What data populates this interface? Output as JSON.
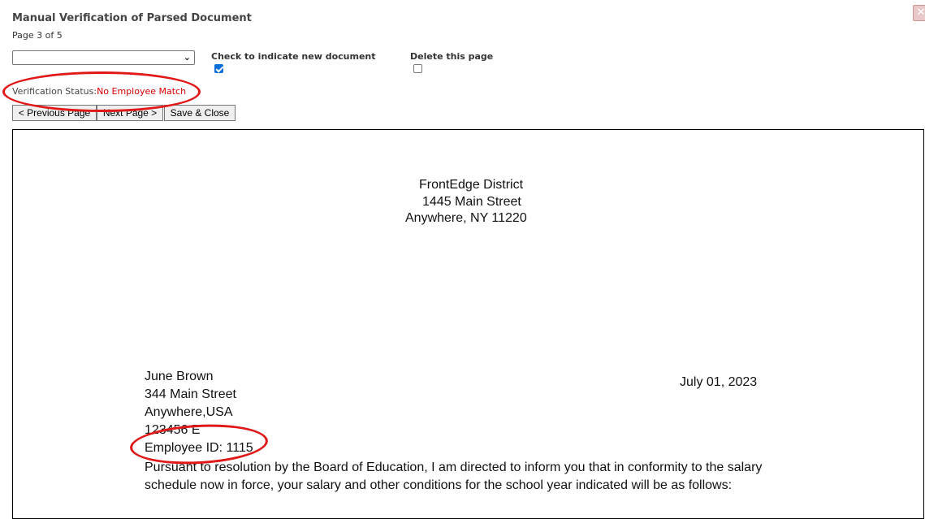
{
  "header": {
    "title": "Manual Verification of Parsed Document",
    "page_info": "Page 3 of 5",
    "close_icon": "close-icon"
  },
  "controls": {
    "document_select_value": "",
    "new_document_label": "Check to indicate new document",
    "new_document_checked": true,
    "delete_page_label": "Delete this page",
    "delete_page_checked": false
  },
  "status": {
    "label": "Verification Status:",
    "value": "No Employee Match",
    "value_color": "#d40000"
  },
  "buttons": {
    "previous": "< Previous Page",
    "next": "Next Page >",
    "save_close": "Save & Close"
  },
  "document": {
    "org_name": "FrontEdge District",
    "org_street": "1445 Main Street",
    "org_city": "Anywhere, NY 11220",
    "recipient_name": "June Brown",
    "recipient_street": "344 Main Street",
    "recipient_city": "Anywhere,USA",
    "recipient_code": "123456 E",
    "employee_id": "Employee ID: 1115",
    "date": "July 01, 2023",
    "body_line1": "Pursuant to resolution by the Board of Education, I am directed to inform you that in conformity to the salary",
    "body_line2": "schedule now in force, your salary and other conditions for the school year indicated will be as follows:"
  },
  "annotation_color": "#e01818"
}
